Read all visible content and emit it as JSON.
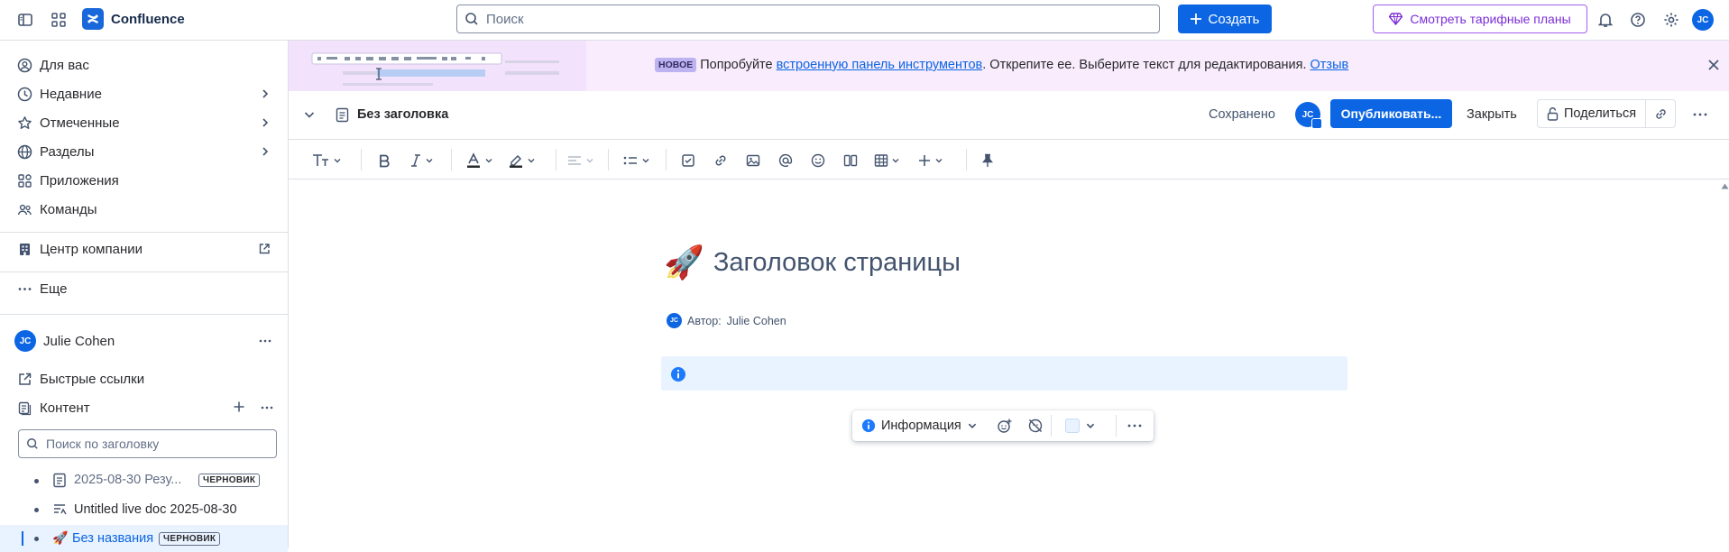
{
  "topbar": {
    "app_name": "Confluence",
    "search_placeholder": "Поиск",
    "create_label": "Создать",
    "plans_label": "Смотреть тарифные планы",
    "user_initials": "JC"
  },
  "sidebar": {
    "nav": [
      {
        "label": "Для вас",
        "icon": "user-circle-icon"
      },
      {
        "label": "Недавние",
        "icon": "clock-icon"
      },
      {
        "label": "Отмеченные",
        "icon": "star-icon"
      },
      {
        "label": "Разделы",
        "icon": "globe-icon"
      },
      {
        "label": "Приложения",
        "icon": "apps-icon"
      },
      {
        "label": "Команды",
        "icon": "people-icon"
      }
    ],
    "company_hub": "Центр компании",
    "more": "Еще",
    "space_name": "Julie Cohen",
    "space_initials": "JC",
    "quick_links": "Быстрые ссылки",
    "content": "Контент",
    "tree_search_placeholder": "Поиск по заголовку",
    "tree": [
      {
        "title": "2025-08-30 Резу...",
        "badge": "ЧЕРНОВИК"
      },
      {
        "title": "Untitled live doc 2025-08-30",
        "badge": ""
      },
      {
        "title": "Без названия",
        "badge": "ЧЕРНОВИК"
      }
    ]
  },
  "banner": {
    "new_badge": "НОВОЕ",
    "text_before": "Попробуйте",
    "link_text": "встроенную панель инструментов",
    "text_after": ". Открепите ее. Выберите текст для редактирования.",
    "feedback": "Отзыв"
  },
  "header": {
    "doc_title": "Без заголовка",
    "saved": "Сохранено",
    "avatar_initials": "JC",
    "publish": "Опубликовать...",
    "close": "Закрыть",
    "share": "Поделиться"
  },
  "editor": {
    "page_title": "Заголовок страницы",
    "author_prefix": "Автор:",
    "author_name": "Julie Cohen",
    "author_initials": "JC",
    "panel_type": "Информация"
  }
}
